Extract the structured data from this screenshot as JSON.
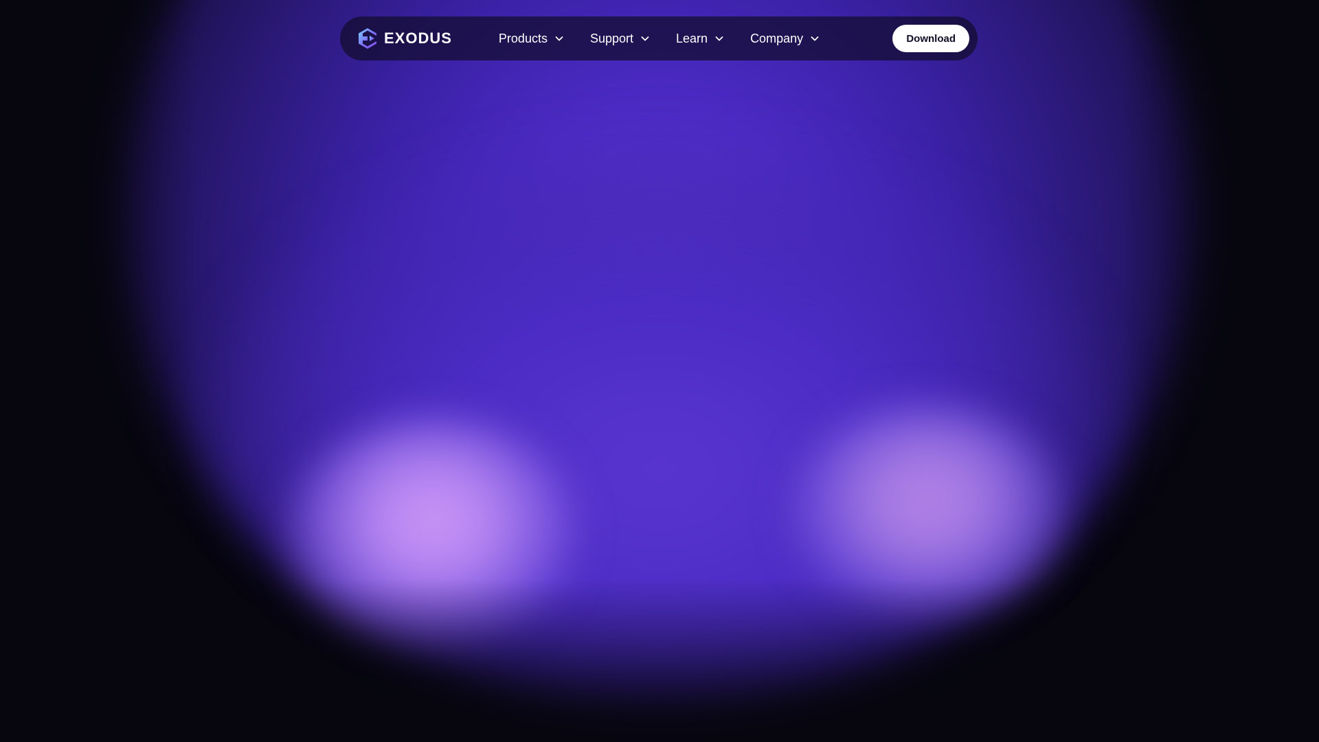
{
  "brand": {
    "name": "EXODUS",
    "logo_icon": "exodus-logo-icon"
  },
  "nav": {
    "items": [
      {
        "label": "Products",
        "icon": "chevron-down-icon"
      },
      {
        "label": "Support",
        "icon": "chevron-down-icon"
      },
      {
        "label": "Learn",
        "icon": "chevron-down-icon"
      },
      {
        "label": "Company",
        "icon": "chevron-down-icon"
      }
    ],
    "download_label": "Download"
  },
  "colors": {
    "background": "#07060f",
    "glow_primary": "#4a2ac2",
    "glow_highlight": "#cc97f6",
    "navbar_bg": "#120c2d",
    "button_bg": "#ffffff",
    "button_text": "#120d26"
  }
}
